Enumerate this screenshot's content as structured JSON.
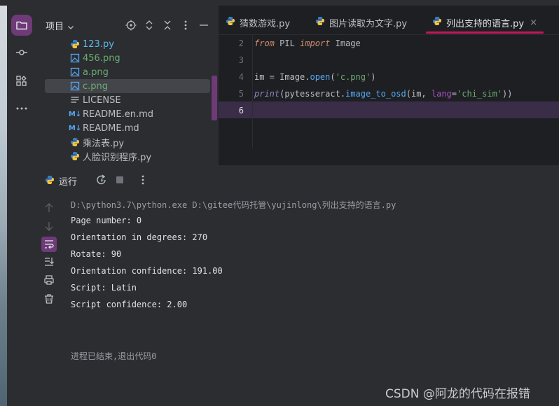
{
  "colors": {
    "accent": "#6e3a78",
    "tab_underline": "#c2185b",
    "background": "#1e1f22",
    "panel": "#2b2d30"
  },
  "activity_bar": {
    "items": [
      "folder-icon",
      "commit-icon",
      "structure-icon",
      "more-icon"
    ]
  },
  "project": {
    "title": "项目",
    "files": [
      {
        "name": "123.py",
        "icon": "python-file-icon",
        "color": "#5fb8e8"
      },
      {
        "name": "456.png",
        "icon": "image-file-icon",
        "color": "#6aab73"
      },
      {
        "name": "a.png",
        "icon": "image-file-icon",
        "color": "#6aab73"
      },
      {
        "name": "c.png",
        "icon": "image-file-icon",
        "color": "#6aab73"
      },
      {
        "name": "LICENSE",
        "icon": "text-file-icon",
        "color": "#bcbec4"
      },
      {
        "name": "README.en.md",
        "icon": "markdown-file-icon",
        "color": "#bcbec4"
      },
      {
        "name": "README.md",
        "icon": "markdown-file-icon",
        "color": "#bcbec4"
      },
      {
        "name": "乘法表.py",
        "icon": "python-file-icon",
        "color": "#bcbec4"
      },
      {
        "name": "人脸识别程序.py",
        "icon": "python-file-icon",
        "color": "#bcbec4"
      }
    ]
  },
  "editor": {
    "tabs": [
      {
        "label": "猜数游戏.py"
      },
      {
        "label": "图片读取为文字.py"
      },
      {
        "label": "列出支持的语言.py",
        "active": true
      }
    ],
    "line_numbers": [
      "2",
      "3",
      "4",
      "5",
      "6"
    ]
  },
  "run": {
    "title": "运行",
    "output": [
      "D:\\python3.7\\python.exe D:\\gitee代码托管\\yujinlong\\列出支持的语言.py",
      "Page number: 0",
      "Orientation in degrees: 270",
      "Rotate: 90",
      "Orientation confidence: 191.00",
      "Script: Latin",
      "Script confidence: 2.00",
      "进程已结束,退出代码0"
    ]
  },
  "watermark": "CSDN @阿龙的代码在报错"
}
